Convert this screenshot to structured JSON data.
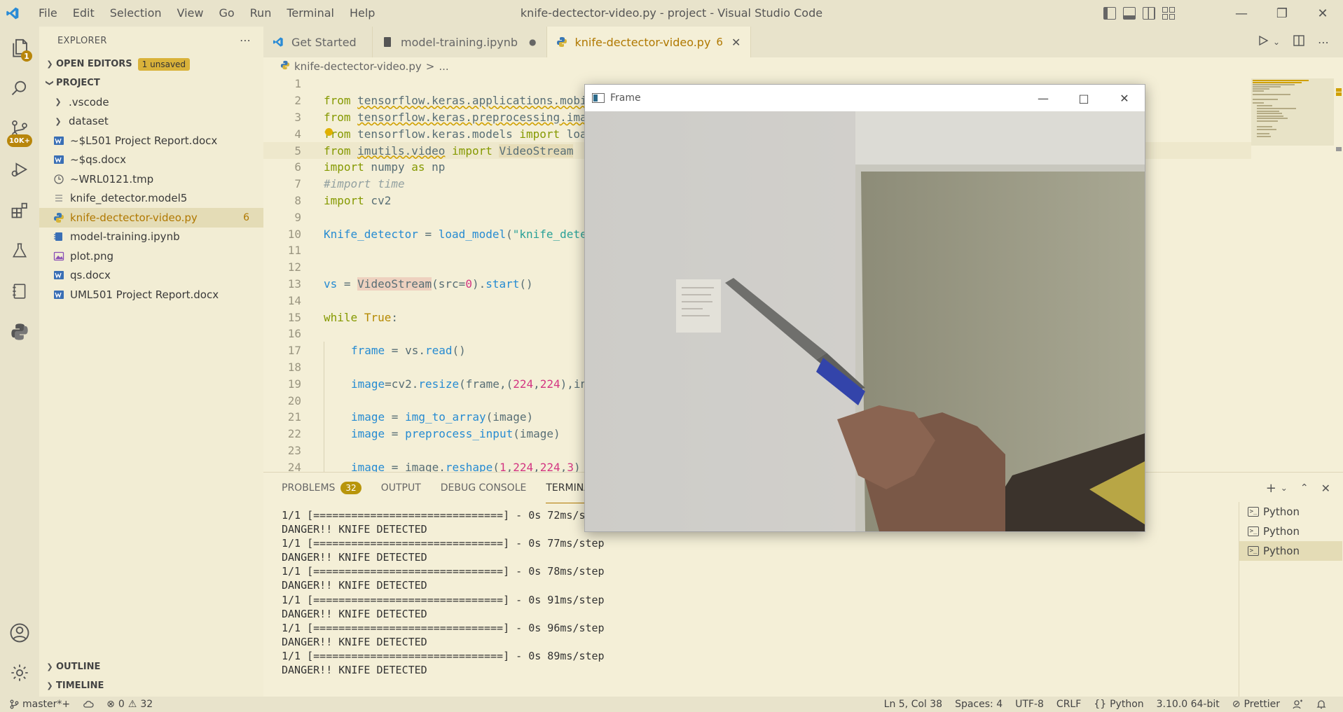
{
  "titlebar": {
    "menu": [
      "File",
      "Edit",
      "Selection",
      "View",
      "Go",
      "Run",
      "Terminal",
      "Help"
    ],
    "title": "knife-dectector-video.py - project - Visual Studio Code"
  },
  "activity": {
    "explorer_badge": "1",
    "scm_badge": "10K+"
  },
  "sidebar": {
    "header": "EXPLORER",
    "open_editors": "OPEN EDITORS",
    "unsaved": "1 unsaved",
    "project": "PROJECT",
    "items": [
      {
        "name": ".vscode",
        "type": "folder"
      },
      {
        "name": "dataset",
        "type": "folder"
      },
      {
        "name": "~$L501 Project Report.docx",
        "type": "word"
      },
      {
        "name": "~$qs.docx",
        "type": "word"
      },
      {
        "name": "~WRL0121.tmp",
        "type": "clock"
      },
      {
        "name": "knife_detector.model5",
        "type": "lines"
      },
      {
        "name": "knife-dectector-video.py",
        "type": "python",
        "count": "6"
      },
      {
        "name": "model-training.ipynb",
        "type": "notebook"
      },
      {
        "name": "plot.png",
        "type": "image"
      },
      {
        "name": "qs.docx",
        "type": "word"
      },
      {
        "name": "UML501 Project Report.docx",
        "type": "word"
      }
    ],
    "outline": "OUTLINE",
    "timeline": "TIMELINE"
  },
  "tabs": [
    {
      "label": "Get Started"
    },
    {
      "label": "model-training.ipynb",
      "modified": "●"
    },
    {
      "label": "knife-dectector-video.py",
      "errors": "6",
      "close": "✕"
    }
  ],
  "breadcrumb": {
    "file": "knife-dectector-video.py",
    "sep": ">",
    "more": "..."
  },
  "editor": {
    "line_numbers": [
      "1",
      "2",
      "3",
      "4",
      "5",
      "6",
      "7",
      "8",
      "9",
      "10",
      "11",
      "12",
      "13",
      "14",
      "15",
      "16",
      "17",
      "18",
      "19",
      "20",
      "21",
      "22",
      "23",
      "24"
    ]
  },
  "panel": {
    "tabs": [
      "PROBLEMS",
      "OUTPUT",
      "DEBUG CONSOLE",
      "TERMINAL"
    ],
    "problems_count": "32",
    "terminal_lines": [
      "1/1 [==============================] - 0s 72ms/step",
      "DANGER!! KNIFE DETECTED",
      "1/1 [==============================] - 0s 77ms/step",
      "DANGER!! KNIFE DETECTED",
      "1/1 [==============================] - 0s 78ms/step",
      "DANGER!! KNIFE DETECTED",
      "1/1 [==============================] - 0s 91ms/step",
      "DANGER!! KNIFE DETECTED",
      "1/1 [==============================] - 0s 96ms/step",
      "DANGER!! KNIFE DETECTED",
      "1/1 [==============================] - 0s 89ms/step",
      "DANGER!! KNIFE DETECTED"
    ],
    "terminals": [
      "Python",
      "Python",
      "Python"
    ]
  },
  "statusbar": {
    "branch": "master*+",
    "errors": "0",
    "warnings": "32",
    "position": "Ln 5, Col 38",
    "spaces": "Spaces: 4",
    "encoding": "UTF-8",
    "eol": "CRLF",
    "language": "Python",
    "interpreter": "3.10.0 64-bit",
    "formatter": "Prettier"
  },
  "frame": {
    "title": "Frame"
  },
  "colors": {
    "accent": "#b07800",
    "background": "#f4efd7",
    "chrome": "#e8e3cb"
  }
}
